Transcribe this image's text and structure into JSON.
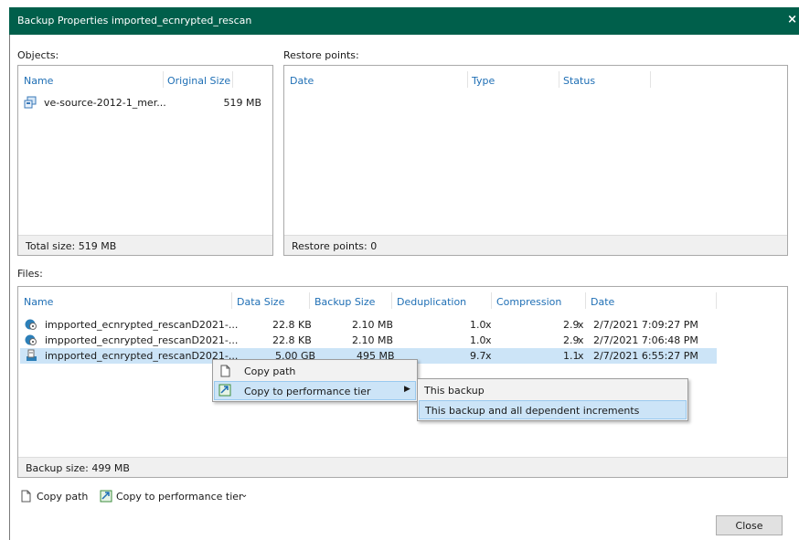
{
  "window": {
    "title": "Backup Properties imported_ecnrypted_rescan",
    "close_glyph": "×"
  },
  "objects": {
    "label": "Objects:",
    "columns": [
      "Name",
      "Original Size"
    ],
    "rows": [
      {
        "name": "ve-source-2012-1_mer...",
        "size": "519 MB",
        "icon": "vm-icon"
      }
    ],
    "footer": "Total size: 519 MB"
  },
  "restore_points": {
    "label": "Restore points:",
    "columns": [
      "Date",
      "Type",
      "Status"
    ],
    "footer": "Restore points: 0"
  },
  "files": {
    "label": "Files:",
    "columns": [
      "Name",
      "Data Size",
      "Backup Size",
      "Deduplication",
      "Compression",
      "Date"
    ],
    "rows": [
      {
        "name": "impported_ecnrypted_rescanD2021-...",
        "data_size": "22.8 KB",
        "backup_size": "2.10 MB",
        "dedup": "1.0",
        "dedup_x": "x",
        "compression": "2.9",
        "compression_x": "x",
        "date": "2/7/2021 7:09:27 PM",
        "icon": "incremental-backup-icon"
      },
      {
        "name": "impported_ecnrypted_rescanD2021-...",
        "data_size": "22.8 KB",
        "backup_size": "2.10 MB",
        "dedup": "1.0",
        "dedup_x": "x",
        "compression": "2.9",
        "compression_x": "x",
        "date": "2/7/2021 7:06:48 PM",
        "icon": "incremental-backup-icon"
      },
      {
        "name": "impported_ecnrypted_rescanD2021-...",
        "data_size": "5.00 GB",
        "backup_size": "495 MB",
        "dedup": "9.7",
        "dedup_x": "x",
        "compression": "1.1",
        "compression_x": "x",
        "date": "2/7/2021 6:55:27 PM",
        "icon": "full-backup-icon",
        "selected": true
      }
    ],
    "footer": "Backup size: 499 MB"
  },
  "context_menu": {
    "items": [
      {
        "label": "Copy path",
        "icon": "copy-path-icon"
      },
      {
        "label": "Copy to performance tier",
        "icon": "performance-tier-icon",
        "has_submenu": true
      }
    ]
  },
  "submenu": {
    "items": [
      {
        "label": "This backup"
      },
      {
        "label": "This backup and all dependent increments"
      }
    ]
  },
  "toolbar": {
    "copy_path": "Copy path",
    "copy_to_tier": "Copy to performance tier"
  },
  "buttons": {
    "close": "Close"
  },
  "colors": {
    "titlebar": "#005f4b",
    "header_text": "#1f6fb5",
    "selection": "#cce4f7"
  }
}
